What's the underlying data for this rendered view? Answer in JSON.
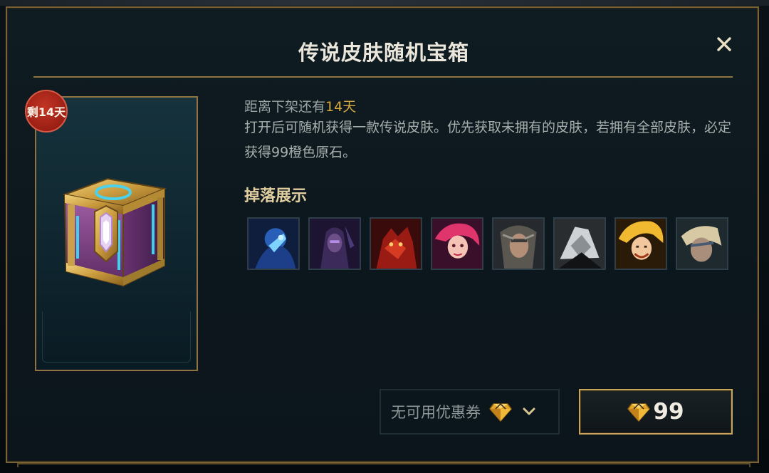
{
  "dialog": {
    "title": "传说皮肤随机宝箱",
    "close_icon": "close-icon"
  },
  "preview": {
    "badge": "剩14天",
    "image": "legendary-skin-chest"
  },
  "info": {
    "remaining_prefix": "距离下架还有",
    "remaining_days": "14天",
    "description": "打开后可随机获得一款传说皮肤。优先获取未拥有的皮肤，若拥有全部皮肤，必定获得99橙色原石。"
  },
  "drops": {
    "title": "掉落展示",
    "items": [
      {
        "icon": "skin-portrait-1"
      },
      {
        "icon": "skin-portrait-2"
      },
      {
        "icon": "skin-portrait-3"
      },
      {
        "icon": "skin-portrait-4"
      },
      {
        "icon": "skin-portrait-5"
      },
      {
        "icon": "skin-portrait-6"
      },
      {
        "icon": "skin-portrait-7"
      },
      {
        "icon": "skin-portrait-8"
      }
    ]
  },
  "footer": {
    "coupon_label": "无可用优惠券",
    "coupon_icon": "gem-icon",
    "dropdown_icon": "chevron-down-icon",
    "price": "99",
    "price_icon": "gem-icon"
  },
  "colors": {
    "gold": "#8e7443",
    "accent_yellow": "#d6a93e",
    "title_text": "#eae6db",
    "badge_red": "#b02a1c"
  }
}
